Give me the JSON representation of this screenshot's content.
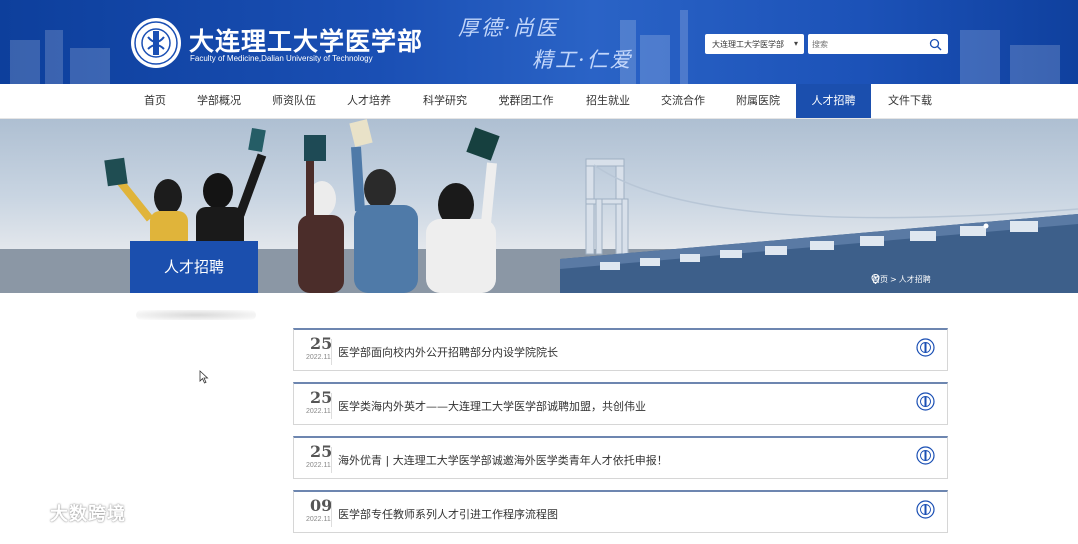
{
  "header": {
    "logo_cn": "大连理工大学医学部",
    "logo_en": "Faculty of Medicine,Dalian University of Technology",
    "motto_line1": "厚德·尚医",
    "motto_line2": "精工·仁爱",
    "site_select_value": "大连理工大学医学部",
    "search_placeholder": "搜索"
  },
  "nav": {
    "items": [
      {
        "label": "首页"
      },
      {
        "label": "学部概况"
      },
      {
        "label": "师资队伍"
      },
      {
        "label": "人才培养"
      },
      {
        "label": "科学研究"
      },
      {
        "label": "党群团工作"
      },
      {
        "label": "招生就业"
      },
      {
        "label": "交流合作"
      },
      {
        "label": "附属医院"
      },
      {
        "label": "人才招聘",
        "active": true
      },
      {
        "label": "文件下载"
      }
    ]
  },
  "banner": {
    "section_title": "人才招聘",
    "breadcrumb": {
      "home": "首页",
      "separator": ">",
      "current": "人才招聘"
    }
  },
  "news": [
    {
      "day": "25",
      "year_month": "2022.11",
      "title": "医学部面向校内外公开招聘部分内设学院院长"
    },
    {
      "day": "25",
      "year_month": "2022.11",
      "title": "医学类海内外英才——大连理工大学医学部诚聘加盟，共创伟业"
    },
    {
      "day": "25",
      "year_month": "2022.11",
      "title": "海外优青 | 大连理工大学医学部诚邀海外医学类青年人才依托申报！"
    },
    {
      "day": "09",
      "year_month": "2022.11",
      "title": "医学部专任教师系列人才引进工作程序流程图"
    }
  ],
  "watermark": "大数跨境",
  "colors": {
    "brand_blue": "#1b4fae",
    "header_blue": "#1a4fb4",
    "item_border_top": "#6d86b0"
  }
}
